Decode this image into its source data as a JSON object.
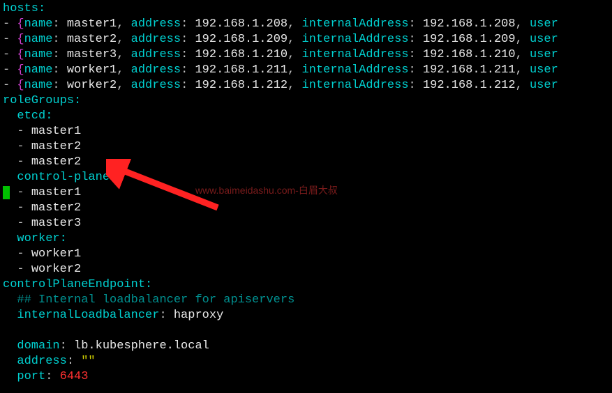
{
  "yaml": {
    "hosts_label": "hosts",
    "hosts": [
      {
        "name": "master1",
        "address": "192.168.1.208",
        "internalAddress": "192.168.1.208",
        "user_partial": "user"
      },
      {
        "name": "master2",
        "address": "192.168.1.209",
        "internalAddress": "192.168.1.209",
        "user_partial": "user"
      },
      {
        "name": "master3",
        "address": "192.168.1.210",
        "internalAddress": "192.168.1.210",
        "user_partial": "user"
      },
      {
        "name": "worker1",
        "address": "192.168.1.211",
        "internalAddress": "192.168.1.211",
        "user_partial": "user"
      },
      {
        "name": "worker2",
        "address": "192.168.1.212",
        "internalAddress": "192.168.1.212",
        "user_partial": "user"
      }
    ],
    "keys": {
      "name": "name",
      "address": "address",
      "internalAddress": "internalAddress"
    },
    "roleGroups_label": "roleGroups",
    "roleGroups": {
      "etcd_label": "etcd",
      "etcd": [
        "master1",
        "master2",
        "master2"
      ],
      "control_plane_label": "control-plane",
      "control_plane": [
        "master1",
        "master2",
        "master3"
      ],
      "worker_label": "worker",
      "worker": [
        "worker1",
        "worker2"
      ]
    },
    "controlPlaneEndpoint_label": "controlPlaneEndpoint",
    "controlPlaneEndpoint": {
      "comment": "## Internal loadbalancer for apiservers",
      "internalLoadbalancer_label": "internalLoadbalancer",
      "internalLoadbalancer_value": "haproxy",
      "domain_label": "domain",
      "domain_value": "lb.kubesphere.local",
      "address_label": "address",
      "address_value": "\"\"",
      "port_label": "port",
      "port_value": "6443"
    }
  },
  "watermark": "www.baimeidashu.com-白眉大叔"
}
